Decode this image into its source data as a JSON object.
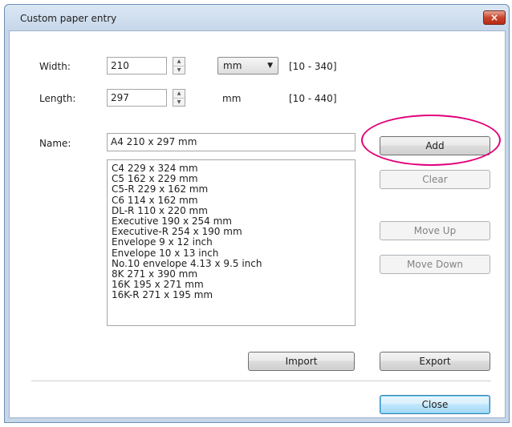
{
  "window": {
    "title": "Custom paper entry",
    "close_glyph": "×"
  },
  "form": {
    "width_label": "Width:",
    "width_value": "210",
    "width_unit": "mm",
    "width_range": "[10 - 340]",
    "length_label": "Length:",
    "length_value": "297",
    "length_unit": "mm",
    "length_range": "[10 - 440]",
    "name_label": "Name:",
    "name_value": "A4 210 x 297 mm"
  },
  "paper_list": [
    "C4 229 x 324 mm",
    "C5 162 x 229 mm",
    "C5-R 229 x 162 mm",
    "C6 114 x 162 mm",
    "DL-R 110 x 220 mm",
    "Executive 190 x 254 mm",
    "Executive-R 254 x 190 mm",
    "Envelope 9 x 12 inch",
    "Envelope 10 x 13 inch",
    "No.10 envelope 4.13 x 9.5 inch",
    "8K 271 x 390 mm",
    "16K 195 x 271 mm",
    "16K-R 271 x 195 mm"
  ],
  "buttons": {
    "add": "Add",
    "clear": "Clear",
    "move_up": "Move Up",
    "move_down": "Move Down",
    "import": "Import",
    "export": "Export",
    "close": "Close"
  },
  "colors": {
    "highlight_ellipse": "#e2007a",
    "window_frame": "#c6d7ea",
    "close_button": "#c8442c"
  }
}
